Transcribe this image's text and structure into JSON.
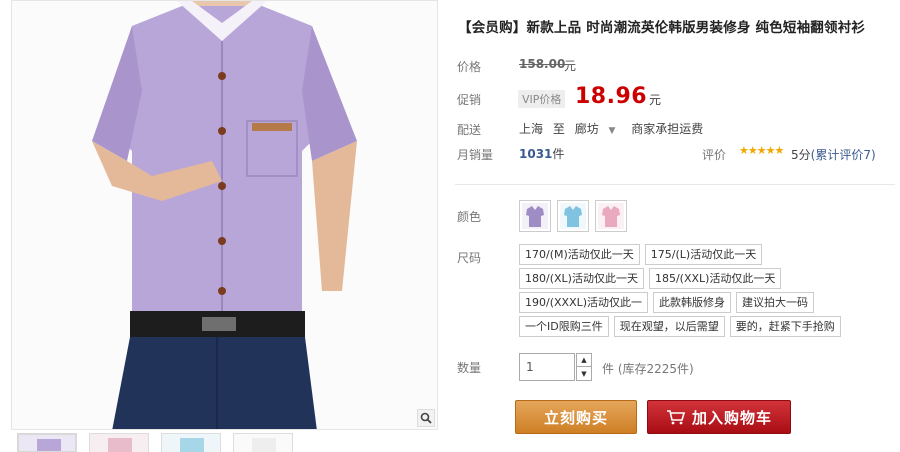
{
  "product": {
    "title": "【会员购】新款上品 时尚潮流英伦韩版男装修身 纯色短袖翻领衬衫"
  },
  "price": {
    "label": "价格",
    "original": "158.00",
    "unit": "元"
  },
  "promo": {
    "label": "促销",
    "vip_tag": "VIP价格",
    "price": "18.96",
    "unit": "元"
  },
  "shipping": {
    "label": "配送",
    "from": "上海",
    "to_word": "至",
    "to": "廊坊",
    "note": "商家承担运费"
  },
  "monthly": {
    "label": "月销量",
    "count": "1031",
    "unit": "件",
    "rating_label": "评价",
    "stars": "★★★★★",
    "score": "5分",
    "reviews": "(累计评价7)"
  },
  "color": {
    "label": "颜色",
    "swatches": [
      "purple",
      "light-blue",
      "pink"
    ]
  },
  "size": {
    "label": "尺码",
    "options": [
      "170/(M)活动仅此一天",
      "175/(L)活动仅此一天",
      "180/(XL)活动仅此一天",
      "185/(XXL)活动仅此一天",
      "190/(XXXL)活动仅此一",
      "此款韩版修身",
      "建议拍大一码",
      "一个ID限购三件",
      "现在观望，以后需望",
      "要的，赶紧下手抢购"
    ]
  },
  "quantity": {
    "label": "数量",
    "value": "1",
    "stock": "件 (库存2225件)"
  },
  "buttons": {
    "buy": "立刻购买",
    "cart": "加入购物车"
  },
  "colors": {
    "price_red": "#cc0000",
    "buy_orange": "#d98a33",
    "cart_red": "#b8161c",
    "link_blue": "#3a5a90"
  }
}
